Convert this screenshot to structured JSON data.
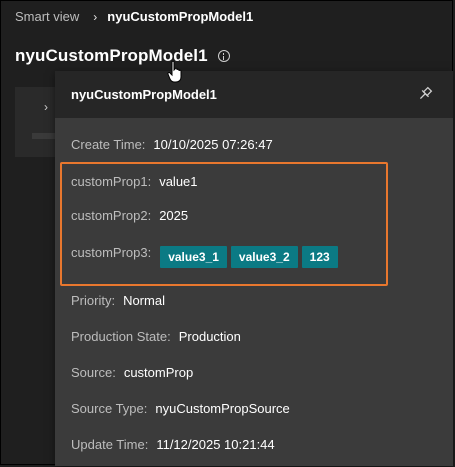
{
  "breadcrumb": {
    "root": "Smart view",
    "separator": "›",
    "current": "nyuCustomPropModel1"
  },
  "page": {
    "title": "nyuCustomPropModel1"
  },
  "popover": {
    "title": "nyuCustomPropModel1",
    "create_time": {
      "label": "Create Time:",
      "value": "10/10/2025 07:26:47"
    },
    "custom_props": [
      {
        "label": "customProp1:",
        "value": "value1"
      },
      {
        "label": "customProp2:",
        "value": "2025"
      },
      {
        "label": "customProp3:",
        "tags": [
          "value3_1",
          "value3_2",
          "123"
        ]
      }
    ],
    "fields": [
      {
        "label": "Priority:",
        "value": "Normal"
      },
      {
        "label": "Production State:",
        "value": "Production"
      },
      {
        "label": "Source:",
        "value": "customProp"
      },
      {
        "label": "Source Type:",
        "value": "nyuCustomPropSource"
      },
      {
        "label": "Update Time:",
        "value": "11/12/2025 10:21:44"
      }
    ]
  },
  "colors": {
    "highlight": "#e8772e",
    "tag_bg": "#0b7a84",
    "popover_bg": "#3b3b3b",
    "header_bg": "#262626"
  },
  "icons": {
    "info": "info-icon",
    "pin": "pin-icon",
    "chevron": "chevron-right-icon",
    "cursor": "hand-pointer-icon"
  }
}
